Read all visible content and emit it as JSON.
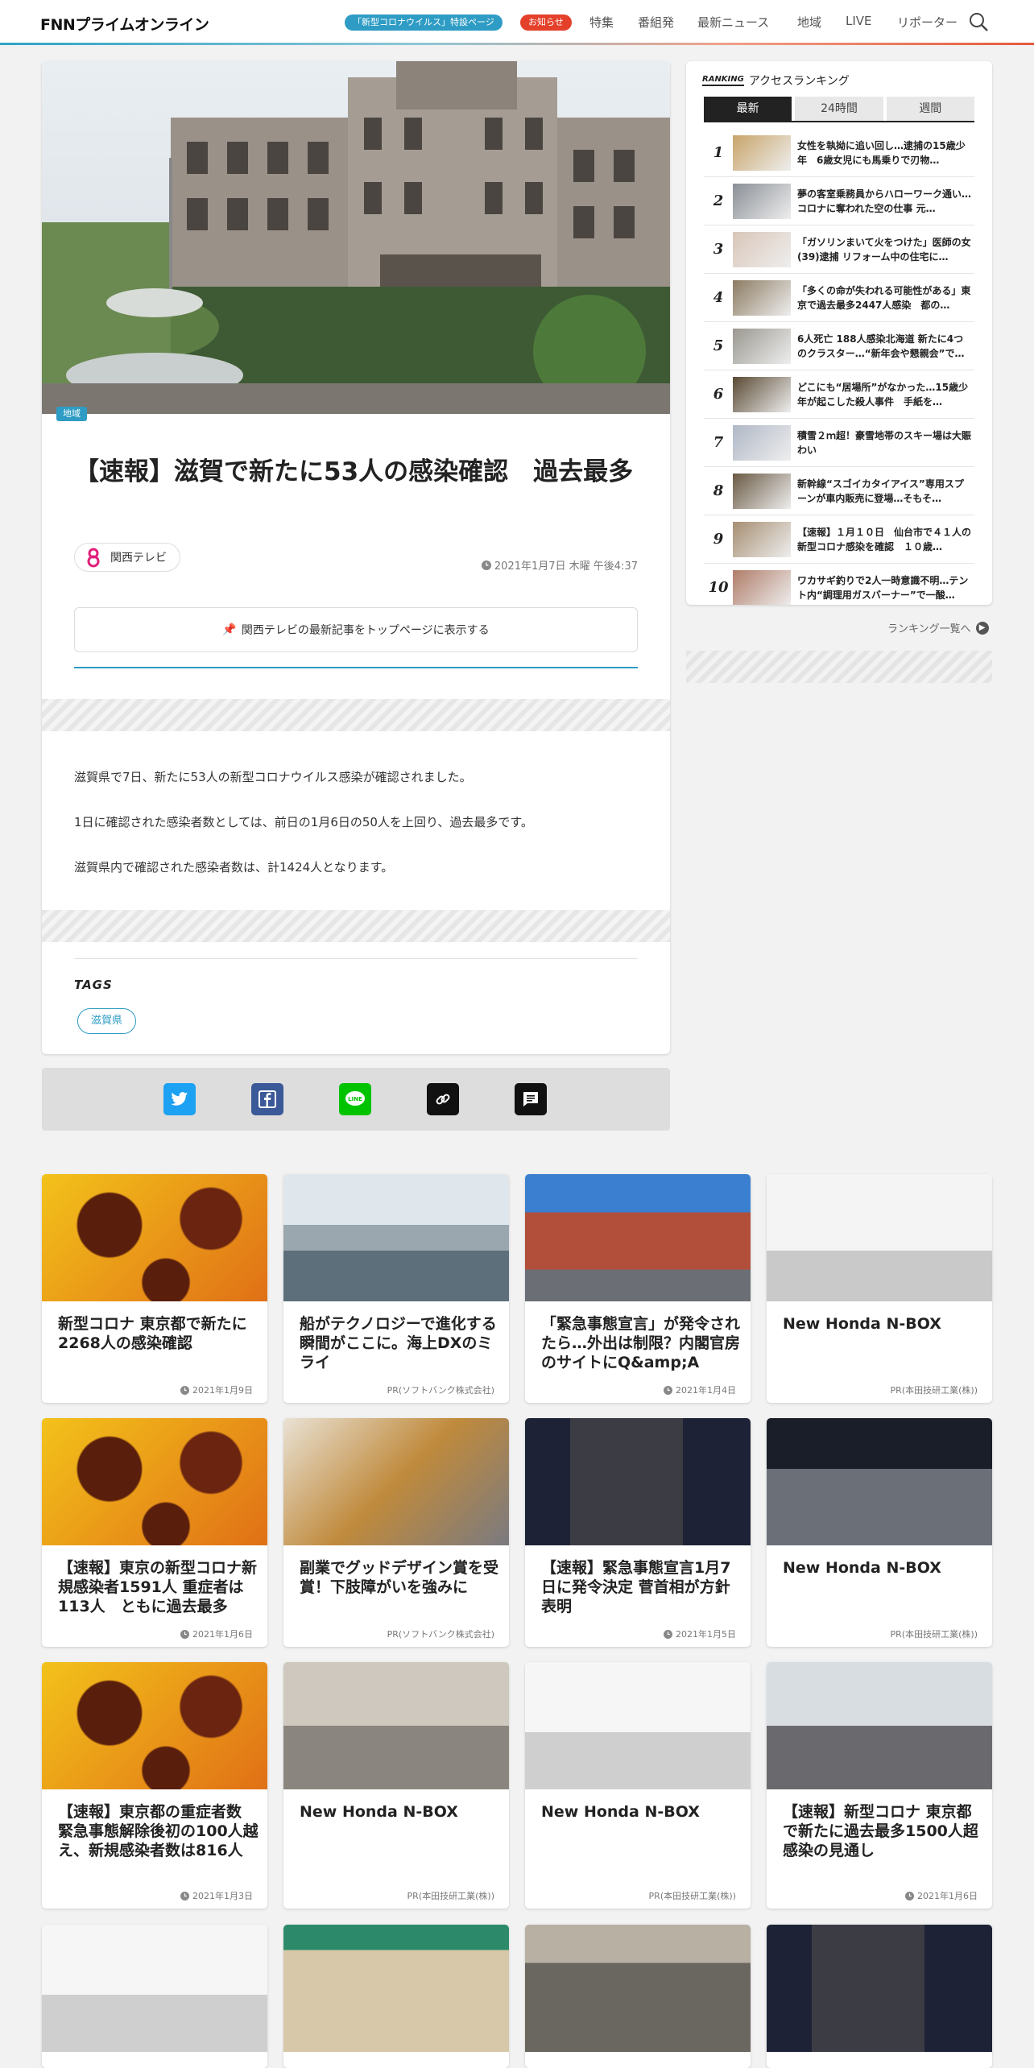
{
  "header": {
    "logo": "FNNプライムオンライン",
    "pill_corona": "「新型コロナウイルス」特設ページ",
    "pill_notice": "お知らせ",
    "nav": [
      "特集",
      "番組発",
      "最新ニュース",
      "地域",
      "LIVE",
      "リポーター"
    ]
  },
  "article": {
    "category_tag": "地域",
    "title": "【速報】滋賀で新たに53人の感染確認　過去最多",
    "source": "関西テレビ",
    "date": "2021年1月7日 木曜 午後4:37",
    "pin_button": "関西テレビの最新記事をトップページに表示する",
    "paragraphs": [
      "滋賀県で7日、新たに53人の新型コロナウイルス感染が確認されました。",
      "1日に確認された感染者数としては、前日の1月6日の50人を上回り、過去最多です。",
      "滋賀県内で確認された感染者数は、計1424人となります。"
    ],
    "tags_heading": "TAGS",
    "tags": [
      "滋賀県"
    ]
  },
  "share": [
    "twitter-icon",
    "facebook-icon",
    "line-icon",
    "link-icon",
    "comment-icon"
  ],
  "ranking": {
    "heading_badge": "RANKING",
    "heading": "アクセスランキング",
    "tabs": [
      "最新",
      "24時間",
      "週間"
    ],
    "active_tab": "最新",
    "items": [
      {
        "rank": "1",
        "text": "女性を執拗に追い回し…逮捕の15歳少年　6歳女児にも馬乗りで刃物…"
      },
      {
        "rank": "2",
        "text": "夢の客室乗務員からハローワーク通い…コロナに奪われた空の仕事 元…"
      },
      {
        "rank": "3",
        "text": "「ガソリンまいて火をつけた」医師の女(39)逮捕 リフォーム中の住宅に…"
      },
      {
        "rank": "4",
        "text": "「多くの命が失われる可能性がある」東京で過去最多2447人感染　都の…"
      },
      {
        "rank": "5",
        "text": "6人死亡 188人感染北海道 新たに4つのクラスター…“新年会や懇親会”で…"
      },
      {
        "rank": "6",
        "text": "どこにも“居場所”がなかった…15歳少年が起こした殺人事件　手紙を…"
      },
      {
        "rank": "7",
        "text": "積雪２ｍ超！豪雪地帯のスキー場は大賑わい"
      },
      {
        "rank": "8",
        "text": "新幹線“スゴイカタイアイス”専用スプーンが車内販売に登場…そもそ…"
      },
      {
        "rank": "9",
        "text": "【速報】１月１０日　仙台市で４１人の新型コロナ感染を確認　１０歳…"
      },
      {
        "rank": "10",
        "text": "ワカサギ釣りで2人一時意識不明…テント内“調理用ガスバーナー”で一酸…"
      }
    ],
    "more": "ランキング一覧へ"
  },
  "cards": [
    {
      "title": "新型コロナ 東京都で新たに2268人の感染確認",
      "meta": "2021年1月9日",
      "clock": true
    },
    {
      "title": "船がテクノロジーで進化する瞬間がここに。海上DXのミライ",
      "meta": "PR(ソフトバンク株式会社)",
      "clock": false
    },
    {
      "title": "「緊急事態宣言」が発令されたら…外出は制限？内閣官房のサイトにQ&amp;A",
      "meta": "2021年1月4日",
      "clock": true
    },
    {
      "title": "New Honda N-BOX",
      "meta": "PR(本田技研工業(株))",
      "clock": false
    },
    {
      "title": "【速報】東京の新型コロナ新規感染者1591人 重症者は113人　ともに過去最多",
      "meta": "2021年1月6日",
      "clock": true
    },
    {
      "title": "副業でグッドデザイン賞を受賞！下肢障がいを強みに",
      "meta": "PR(ソフトバンク株式会社)",
      "clock": false
    },
    {
      "title": "【速報】緊急事態宣言1月7日に発令決定 菅首相が方針表明",
      "meta": "2021年1月5日",
      "clock": true
    },
    {
      "title": "New Honda N-BOX",
      "meta": "PR(本田技研工業(株))",
      "clock": false
    },
    {
      "title": "【速報】東京都の重症者数 緊急事態解除後初の100人越え、新規感染者数は816人",
      "meta": "2021年1月3日",
      "clock": true
    },
    {
      "title": "New Honda N-BOX",
      "meta": "PR(本田技研工業(株))",
      "clock": false
    },
    {
      "title": "New Honda N-BOX",
      "meta": "PR(本田技研工業(株))",
      "clock": false
    },
    {
      "title": "【速報】新型コロナ 東京都で新たに過去最多1500人超感染の見通し",
      "meta": "2021年1月6日",
      "clock": true
    }
  ],
  "colors": {
    "accent": "#2e9cc4",
    "notice": "#e4402a",
    "twitter": "#1da1f2",
    "facebook": "#3b5998",
    "line": "#00c300"
  }
}
